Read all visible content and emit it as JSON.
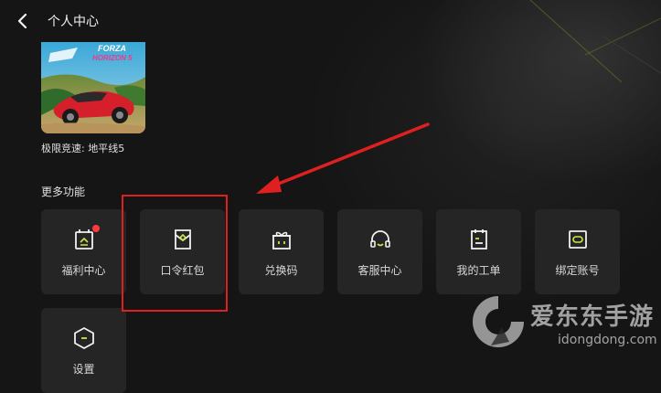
{
  "header": {
    "title": "个人中心"
  },
  "game": {
    "caption": "极限竞速: 地平线5",
    "cover_text_top": "FORZA",
    "cover_text_bottom": "HORIZON 5"
  },
  "section": {
    "title": "更多功能"
  },
  "tiles": [
    {
      "label": "福利中心",
      "icon": "gift-bag-icon",
      "badge": true
    },
    {
      "label": "口令红包",
      "icon": "red-envelope-icon",
      "badge": false
    },
    {
      "label": "兑换码",
      "icon": "redeem-gift-icon",
      "badge": false
    },
    {
      "label": "客服中心",
      "icon": "headset-icon",
      "badge": false
    },
    {
      "label": "我的工单",
      "icon": "ticket-list-icon",
      "badge": false
    },
    {
      "label": "绑定账号",
      "icon": "bind-account-icon",
      "badge": false
    },
    {
      "label": "设置",
      "icon": "hexagon-settings-icon",
      "badge": false
    }
  ],
  "watermark": {
    "brand": "爱东东手游",
    "url": "idongdong.com"
  },
  "colors": {
    "accent": "#c7e84a",
    "badge": "#ff3b3b",
    "annotation": "#e02020",
    "tile_bg": "#252525",
    "page_bg": "#151515"
  }
}
